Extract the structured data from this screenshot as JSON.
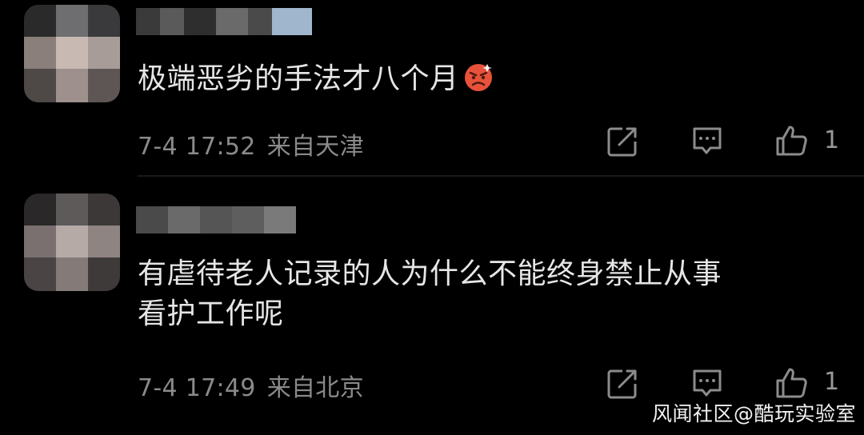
{
  "comments": [
    {
      "text": "极端恶劣的手法才八个月",
      "emoji": "angry-face-emoji",
      "time": "7-4 17:52",
      "location": "来自天津",
      "likes": "1"
    },
    {
      "text_line1": "有虐待老人记录的人为什么不能终身禁止从事",
      "text_line2": "看护工作呢",
      "time": "7-4 17:49",
      "location": "来自北京",
      "likes": "1"
    }
  ],
  "icons": {
    "share": "share-icon",
    "reply": "reply-icon",
    "like": "thumbs-up-icon"
  },
  "watermark": "风闻社区@酷玩实验室",
  "colors": {
    "background": "#000000",
    "text": "#e6e6e6",
    "meta": "#8a8a8a"
  }
}
